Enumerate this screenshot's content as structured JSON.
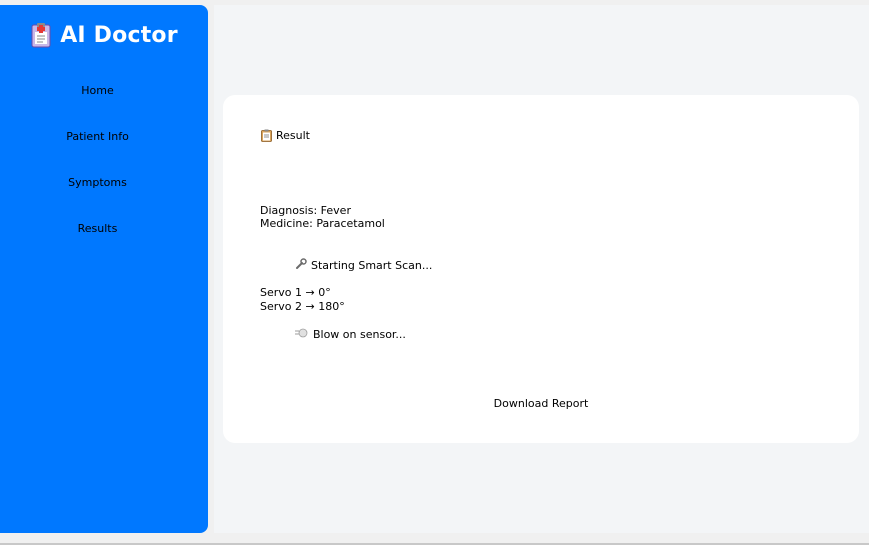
{
  "app": {
    "title": "AI Doctor"
  },
  "sidebar": {
    "items": [
      {
        "label": "Home"
      },
      {
        "label": "Patient Info"
      },
      {
        "label": "Symptoms"
      },
      {
        "label": "Results"
      }
    ]
  },
  "result": {
    "header": "Result",
    "diagnosis": "Diagnosis: Fever",
    "medicine": "Medicine: Paracetamol",
    "scan_start": "Starting Smart Scan...",
    "servo1": "Servo 1 → 0°",
    "servo2": "Servo 2 → 180°",
    "sensor": "Blow on sensor...",
    "download_label": "Download Report"
  },
  "colors": {
    "sidebar": "#0078ff",
    "main_background": "#f3f5f7",
    "card": "#ffffff"
  },
  "icons": {
    "brand": "medical-clipboard-icon",
    "result": "clipboard-icon",
    "scan": "wrench-icon",
    "sensor": "wind-icon"
  }
}
